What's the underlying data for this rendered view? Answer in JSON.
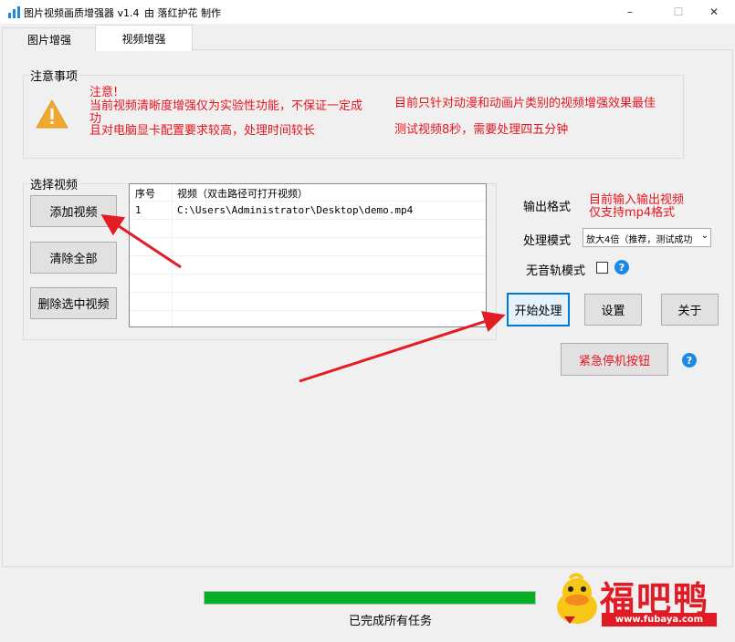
{
  "window": {
    "title": "图片视频画质增强器 v1.4",
    "byline": "由 落红护花 制作",
    "controls": [
      "–",
      "☐",
      "✕"
    ]
  },
  "tabs": [
    {
      "label": "图片增强",
      "active": false
    },
    {
      "label": "视频增强",
      "active": true
    }
  ],
  "notice": {
    "group_title": "注意事项",
    "line1": "注意!",
    "line2": "当前视频清晰度增强仅为实验性功能，不保证一定成",
    "line3": "功",
    "line4": "且对电脑显卡配置要求较高，处理时间较长",
    "right_line1": "目前只针对动漫和动画片类别的视频增强效果最佳",
    "right_line2": "测试视频8秒，需要处理四五分钟",
    "icon": "warning-icon"
  },
  "select_video": {
    "group_title": "选择视频",
    "add_label": "添加视频",
    "clear_label": "清除全部",
    "delete_label": "删除选中视频"
  },
  "table": {
    "headers": [
      "序号",
      "视频（双击路径可打开视频）"
    ],
    "rows": [
      [
        "1",
        "C:\\Users\\Administrator\\Desktop\\demo.mp4"
      ]
    ]
  },
  "output": {
    "format_label": "输出格式",
    "format_note_line1": "目前输入输出视频",
    "format_note_line2": "仅支持mp4格式",
    "mode_label": "处理模式",
    "mode_value": "放大4倍（推荐，测试成功",
    "mute_label": "无音轨模式",
    "mute_checked": false
  },
  "actions": {
    "start_label": "开始处理",
    "settings_label": "设置",
    "about_label": "关于",
    "emergency_label": "紧急停机按钮"
  },
  "status": {
    "progress": 1.0,
    "text": "已完成所有任务"
  },
  "watermark": {
    "brand": "福吧鸭",
    "url": "www.fubaya.com"
  },
  "colors": {
    "notice_red": "#e8141e",
    "progress_green": "#06b025",
    "help_blue": "#1e88e5",
    "arrow_red": "#e31b23"
  }
}
